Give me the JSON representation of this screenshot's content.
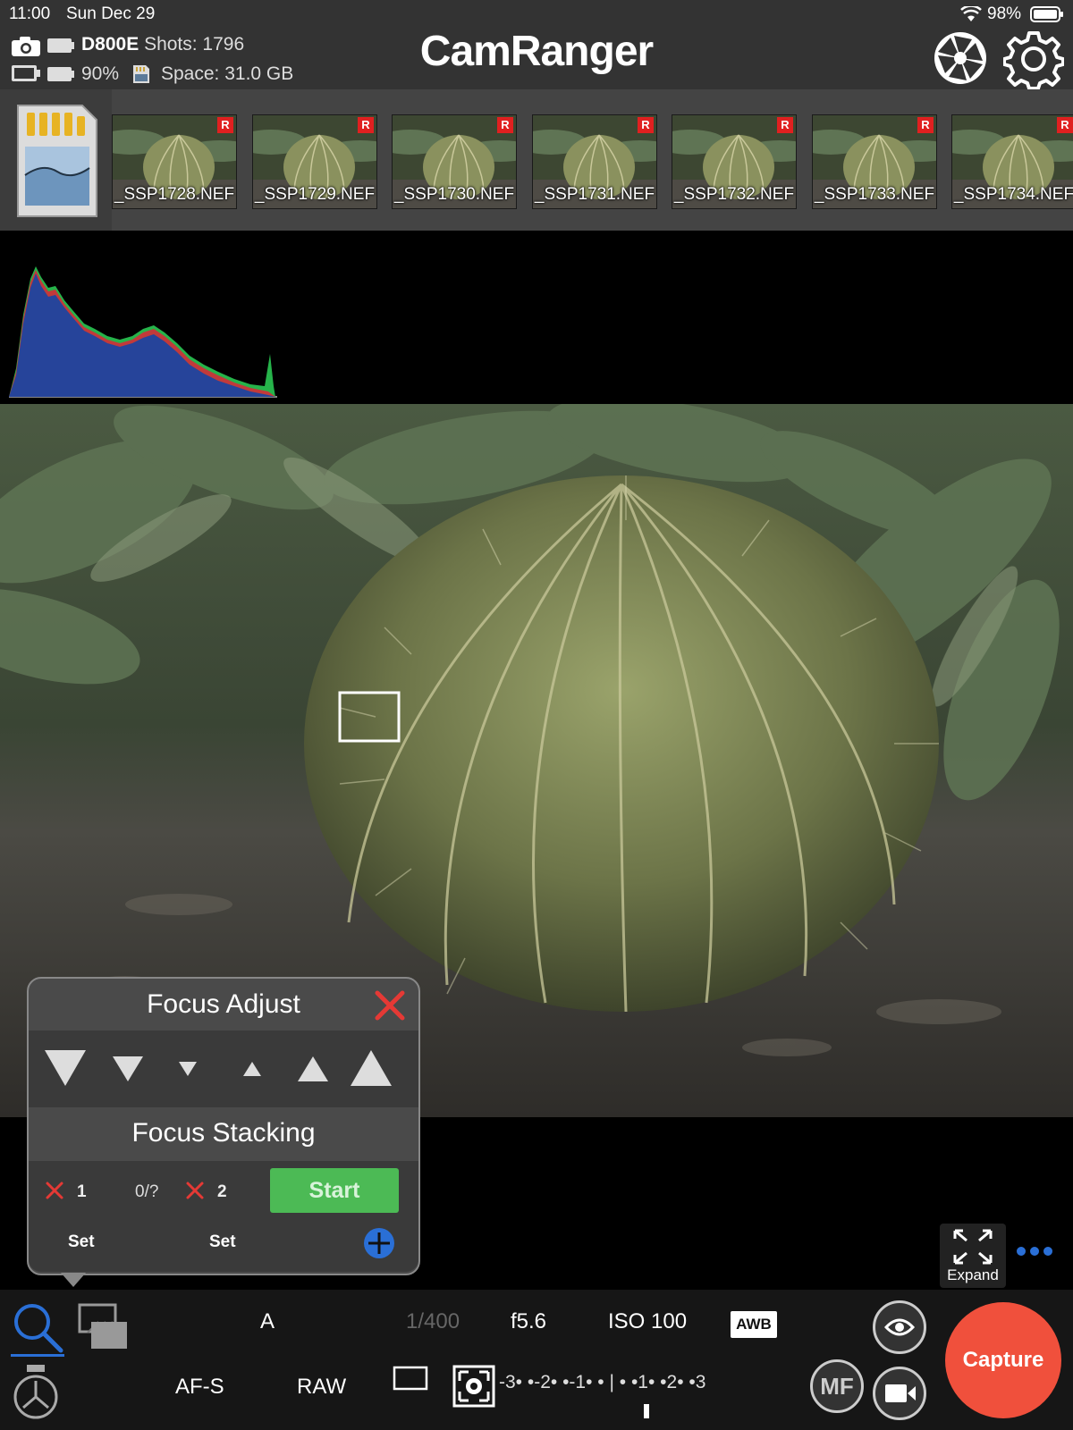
{
  "status_bar": {
    "time": "11:00",
    "date": "Sun Dec 29",
    "battery": "98%"
  },
  "camera": {
    "model": "D800E",
    "shots": "Shots: 1796",
    "battery_level": "90%",
    "space": "Space: 31.0 GB"
  },
  "app_title": "CamRanger",
  "thumbnails": [
    {
      "name": "_SSP1728.NEF",
      "badge": "R"
    },
    {
      "name": "_SSP1729.NEF",
      "badge": "R"
    },
    {
      "name": "_SSP1730.NEF",
      "badge": "R"
    },
    {
      "name": "_SSP1731.NEF",
      "badge": "R"
    },
    {
      "name": "_SSP1732.NEF",
      "badge": "R"
    },
    {
      "name": "_SSP1733.NEF",
      "badge": "R"
    },
    {
      "name": "_SSP1734.NEF",
      "badge": "R"
    }
  ],
  "focus_adjust": {
    "title": "Focus Adjust",
    "buttons": [
      "focus-near-large",
      "focus-near-medium",
      "focus-near-small",
      "focus-far-small",
      "focus-far-medium",
      "focus-far-large"
    ]
  },
  "focus_stacking": {
    "title": "Focus Stacking",
    "point1": "1",
    "progress": "0/?",
    "point2": "2",
    "start_label": "Start",
    "set1_label": "Set",
    "set2_label": "Set"
  },
  "expand_label": "Expand",
  "bottom_bar": {
    "mode": "A",
    "shutter": "1/400",
    "aperture": "f5.6",
    "iso": "ISO 100",
    "wb": "AWB",
    "af_mode": "AF-S",
    "format": "RAW",
    "exposure_scale": "-3• •-2• •-1• • | • •1• •2• •3",
    "mf_label": "MF",
    "capture_label": "Capture"
  },
  "colors": {
    "capture": "#f0503c",
    "start": "#4cba55",
    "close": "#e53935",
    "accent": "#2a6fd6"
  }
}
